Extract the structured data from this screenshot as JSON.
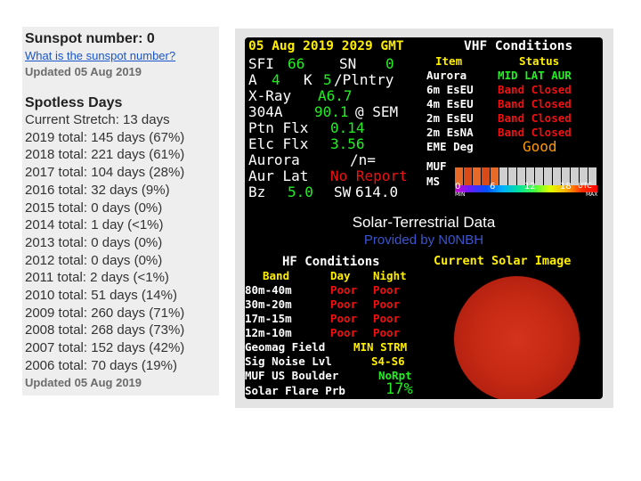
{
  "left": {
    "sunspot_title": "Sunspot number: 0",
    "sunspot_link": "What is the sunspot number?",
    "updated_top": "Updated 05 Aug 2019",
    "spotless_title": "Spotless Days",
    "rows": [
      "Current Stretch: 13 days",
      "2019 total: 145 days (67%)",
      "2018 total: 221 days (61%)",
      "2017 total: 104 days (28%)",
      "2016 total: 32 days (9%)",
      "2015 total: 0 days (0%)",
      "2014 total: 1 day (<1%)",
      "2013 total: 0 days (0%)",
      "2012 total: 0 days (0%)",
      "2011 total: 2 days (<1%)",
      "2010 total: 51 days (14%)",
      "2009 total: 260 days (71%)",
      "2008 total: 268 days (73%)",
      "2007 total: 152 days (42%)",
      "2006 total: 70 days (19%)"
    ],
    "updated_bottom": "Updated 05 Aug 2019"
  },
  "dash": {
    "header_date": "05 Aug 2019 2029 GMT",
    "sfi_label": "SFI",
    "sfi": "66",
    "sn_label": "SN",
    "sn": "0",
    "a_label": "A",
    "a": "4",
    "k_label": "K",
    "k": "5",
    "k_suffix": "/Plntry",
    "xray_label": "X-Ray",
    "xray": "A6.7",
    "a304_label": "304A",
    "a304": "90.1",
    "a304_suffix": "@ SEM",
    "ptn_label": "Ptn Flx",
    "ptn": "0.14",
    "elc_label": "Elc Flx",
    "elc": "3.56",
    "aurora_label": "Aurora",
    "aurora": "/n=",
    "aurlat_label": "Aur Lat",
    "aurlat": "No Report",
    "bz_label": "Bz",
    "bz": "5.0",
    "sw_label": "SW",
    "sw": "614.0",
    "vhf": {
      "title": "VHF Conditions",
      "col_item": "Item",
      "col_status": "Status",
      "aurora_label": "Aurora",
      "aurora_value": "MID LAT AUR",
      "rows": [
        {
          "item": "6m EsEU",
          "status": "Band Closed"
        },
        {
          "item": "4m EsEU",
          "status": "Band Closed"
        },
        {
          "item": "2m EsEU",
          "status": "Band Closed"
        },
        {
          "item": "2m EsNA",
          "status": "Band Closed"
        }
      ],
      "eme_label": "EME Deg",
      "eme_value": "Good",
      "muf_label": "MUF",
      "ms_label": "MS",
      "muf_level": 0.34,
      "scale": {
        "t0": "0",
        "t6": "6",
        "t12": "12",
        "t18": "18",
        "utc": "UTC",
        "min": "MIN",
        "max": "MAX"
      }
    },
    "solar_title": "Solar-Terrestrial Data",
    "provider": "Provided by N0NBH",
    "hf": {
      "title": "HF Conditions",
      "col_band": "Band",
      "col_day": "Day",
      "col_night": "Night",
      "rows": [
        {
          "band": "80m-40m",
          "day": "Poor",
          "night": "Poor"
        },
        {
          "band": "30m-20m",
          "day": "Poor",
          "night": "Poor"
        },
        {
          "band": "17m-15m",
          "day": "Poor",
          "night": "Poor"
        },
        {
          "band": "12m-10m",
          "day": "Poor",
          "night": "Poor"
        }
      ],
      "geomag_label": "Geomag Field",
      "geomag": "MIN STRM",
      "signoise_label": "Sig Noise Lvl",
      "signoise": "S4-S6",
      "muf_us_label": "MUF US Boulder",
      "muf_us": "NoRpt",
      "flare_label": "Solar Flare Prb",
      "flare": "17%"
    },
    "solar_image_title": "Current Solar Image",
    "colors": {
      "yellow": "#ffee00",
      "green": "#22ee22",
      "red": "#ee1111",
      "orange": "#ff9900",
      "link": "#1a55cc"
    }
  }
}
